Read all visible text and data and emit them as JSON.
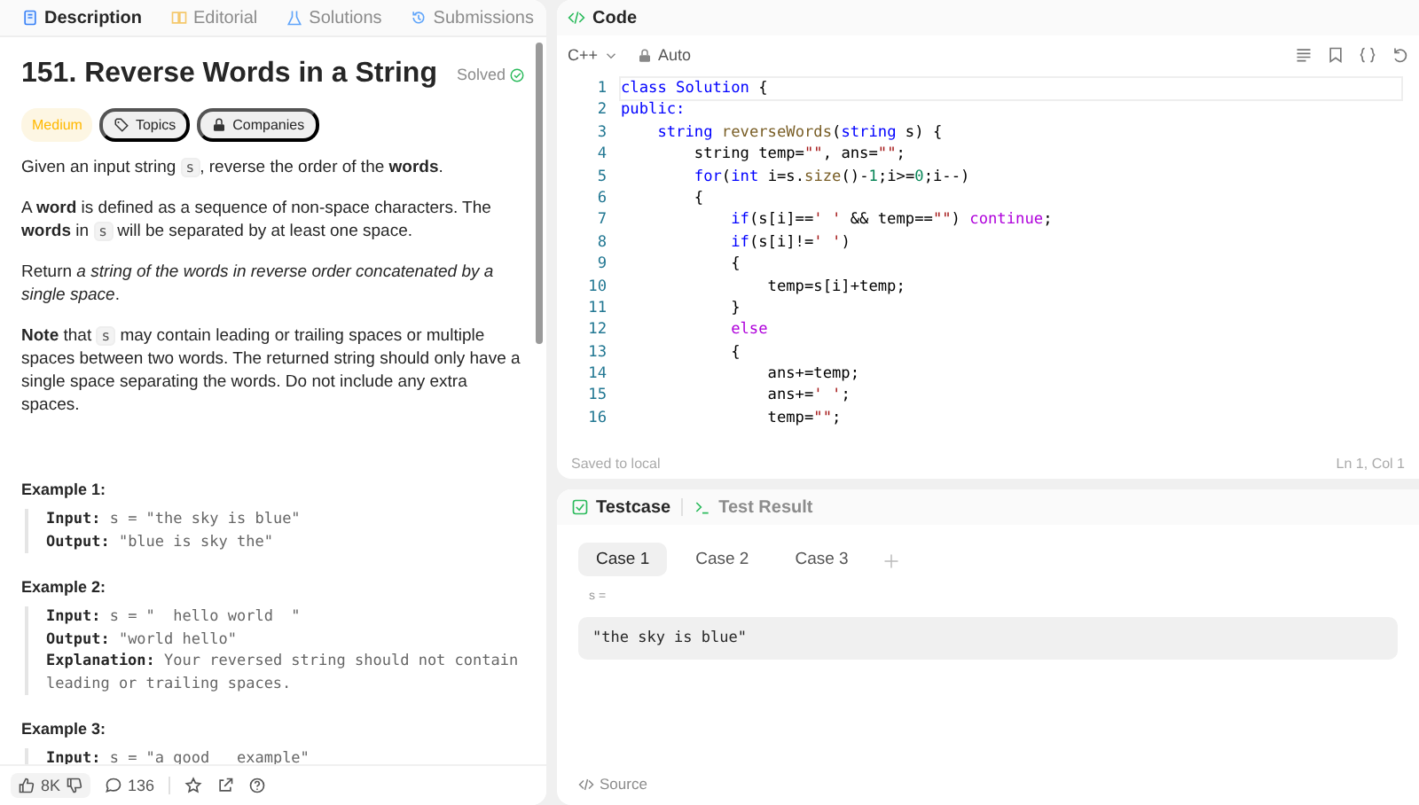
{
  "left_tabs": [
    {
      "label": "Description",
      "selected": true
    },
    {
      "label": "Editorial",
      "selected": false
    },
    {
      "label": "Solutions",
      "selected": false
    },
    {
      "label": "Submissions",
      "selected": false
    }
  ],
  "problem": {
    "title": "151. Reverse Words in a String",
    "status": "Solved",
    "difficulty": "Medium",
    "tags": [
      {
        "label": "Topics"
      },
      {
        "label": "Companies"
      }
    ],
    "paragraphs": [
      [
        {
          "kind": "text",
          "text": "Given an input string "
        },
        {
          "kind": "code",
          "text": "s"
        },
        {
          "kind": "text",
          "text": ", reverse the order of the **words**."
        }
      ],
      [
        {
          "kind": "text",
          "text": "A **word** is defined as a sequence of non-space characters. The **words** in "
        },
        {
          "kind": "code",
          "text": "s"
        },
        {
          "kind": "text",
          "text": " will be separated by at least one space."
        }
      ],
      [
        {
          "kind": "text",
          "text": "Return *a string of the words in reverse order concatenated by a single space*."
        }
      ],
      [
        {
          "kind": "text",
          "text": "**Note** that "
        },
        {
          "kind": "code",
          "text": "s"
        },
        {
          "kind": "text",
          "text": " may contain leading or trailing spaces or multiple spaces between two words. The returned string should only have a single space separating the words. Do not include any extra spaces."
        }
      ]
    ],
    "examples": [
      {
        "heading": "Example 1:",
        "lines": [
          "**Input:** s = \"the sky is blue\"",
          "**Output:** \"blue is sky the\""
        ]
      },
      {
        "heading": "Example 2:",
        "lines": [
          "**Input:** s = \"  hello world  \"",
          "**Output:** \"world hello\"",
          "**Explanation:** Your reversed string should not contain leading or trailing spaces."
        ]
      },
      {
        "heading": "Example 3:",
        "lines": [
          "**Input:** s = \"a good   example\""
        ]
      }
    ]
  },
  "footer": {
    "likes": "8K",
    "comments": "136"
  },
  "code_panel": {
    "title": "Code",
    "language": "C++",
    "mode": "Auto",
    "status": "Saved to local",
    "cursor": "Ln 1, Col 1",
    "lines": [
      {
        "number": "1",
        "tokens": [
          {
            "kind": "keyword",
            "text": "class"
          },
          {
            "kind": "type",
            "text": " Solution"
          },
          {
            "kind": "plain",
            "text": " {"
          }
        ]
      },
      {
        "number": "2",
        "tokens": [
          {
            "kind": "keyword",
            "text": "public:"
          }
        ]
      },
      {
        "number": "3",
        "tokens": [
          {
            "kind": "keyword",
            "text": "    string"
          },
          {
            "kind": "function",
            "text": " reverseWords"
          },
          {
            "kind": "plain",
            "text": "("
          },
          {
            "kind": "keyword",
            "text": "string"
          },
          {
            "kind": "plain",
            "text": " s) {"
          }
        ]
      },
      {
        "number": "4",
        "tokens": [
          {
            "kind": "plain",
            "text": "        string temp="
          },
          {
            "kind": "string",
            "text": "\"\""
          },
          {
            "kind": "plain",
            "text": ", ans="
          },
          {
            "kind": "string",
            "text": "\"\""
          },
          {
            "kind": "plain",
            "text": ";"
          }
        ]
      },
      {
        "number": "5",
        "tokens": [
          {
            "kind": "keyword",
            "text": "        for"
          },
          {
            "kind": "plain",
            "text": "("
          },
          {
            "kind": "keyword",
            "text": "int"
          },
          {
            "kind": "plain",
            "text": " i=s."
          },
          {
            "kind": "function",
            "text": "size"
          },
          {
            "kind": "plain",
            "text": "()-"
          },
          {
            "kind": "number",
            "text": "1"
          },
          {
            "kind": "plain",
            "text": ";i>="
          },
          {
            "kind": "number",
            "text": "0"
          },
          {
            "kind": "plain",
            "text": ";i--)"
          }
        ]
      },
      {
        "number": "6",
        "tokens": [
          {
            "kind": "plain",
            "text": "        {"
          }
        ]
      },
      {
        "number": "7",
        "tokens": [
          {
            "kind": "keyword",
            "text": "            if"
          },
          {
            "kind": "plain",
            "text": "(s[i]=="
          },
          {
            "kind": "string",
            "text": "' '"
          },
          {
            "kind": "plain",
            "text": " && temp=="
          },
          {
            "kind": "string",
            "text": "\"\""
          },
          {
            "kind": "plain",
            "text": ")"
          },
          {
            "kind": "control",
            "text": " continue"
          },
          {
            "kind": "plain",
            "text": ";"
          }
        ]
      },
      {
        "number": "8",
        "tokens": [
          {
            "kind": "keyword",
            "text": "            if"
          },
          {
            "kind": "plain",
            "text": "(s[i]!="
          },
          {
            "kind": "string",
            "text": "' '"
          },
          {
            "kind": "plain",
            "text": ")"
          }
        ]
      },
      {
        "number": "9",
        "tokens": [
          {
            "kind": "plain",
            "text": "            {"
          }
        ]
      },
      {
        "number": "10",
        "tokens": [
          {
            "kind": "plain",
            "text": "                temp=s[i]+temp;"
          }
        ]
      },
      {
        "number": "11",
        "tokens": [
          {
            "kind": "plain",
            "text": "            }"
          }
        ]
      },
      {
        "number": "12",
        "tokens": [
          {
            "kind": "control",
            "text": "            else"
          }
        ]
      },
      {
        "number": "13",
        "tokens": [
          {
            "kind": "plain",
            "text": "            {"
          }
        ]
      },
      {
        "number": "14",
        "tokens": [
          {
            "kind": "plain",
            "text": "                ans+=temp;"
          }
        ]
      },
      {
        "number": "15",
        "tokens": [
          {
            "kind": "plain",
            "text": "                ans+="
          },
          {
            "kind": "string",
            "text": "' '"
          },
          {
            "kind": "plain",
            "text": ";"
          }
        ]
      },
      {
        "number": "16",
        "tokens": [
          {
            "kind": "plain",
            "text": "                temp="
          },
          {
            "kind": "string",
            "text": "\"\""
          },
          {
            "kind": "plain",
            "text": ";"
          }
        ]
      }
    ]
  },
  "bottom_tabs": [
    {
      "label": "Testcase",
      "selected": true
    },
    {
      "label": "Test Result",
      "selected": false
    }
  ],
  "cases": [
    {
      "label": "Case 1",
      "selected": true
    },
    {
      "label": "Case 2",
      "selected": false
    },
    {
      "label": "Case 3",
      "selected": false
    }
  ],
  "case_input": {
    "name": "s =",
    "value": "\"the sky is blue\""
  },
  "source_label": "Source"
}
